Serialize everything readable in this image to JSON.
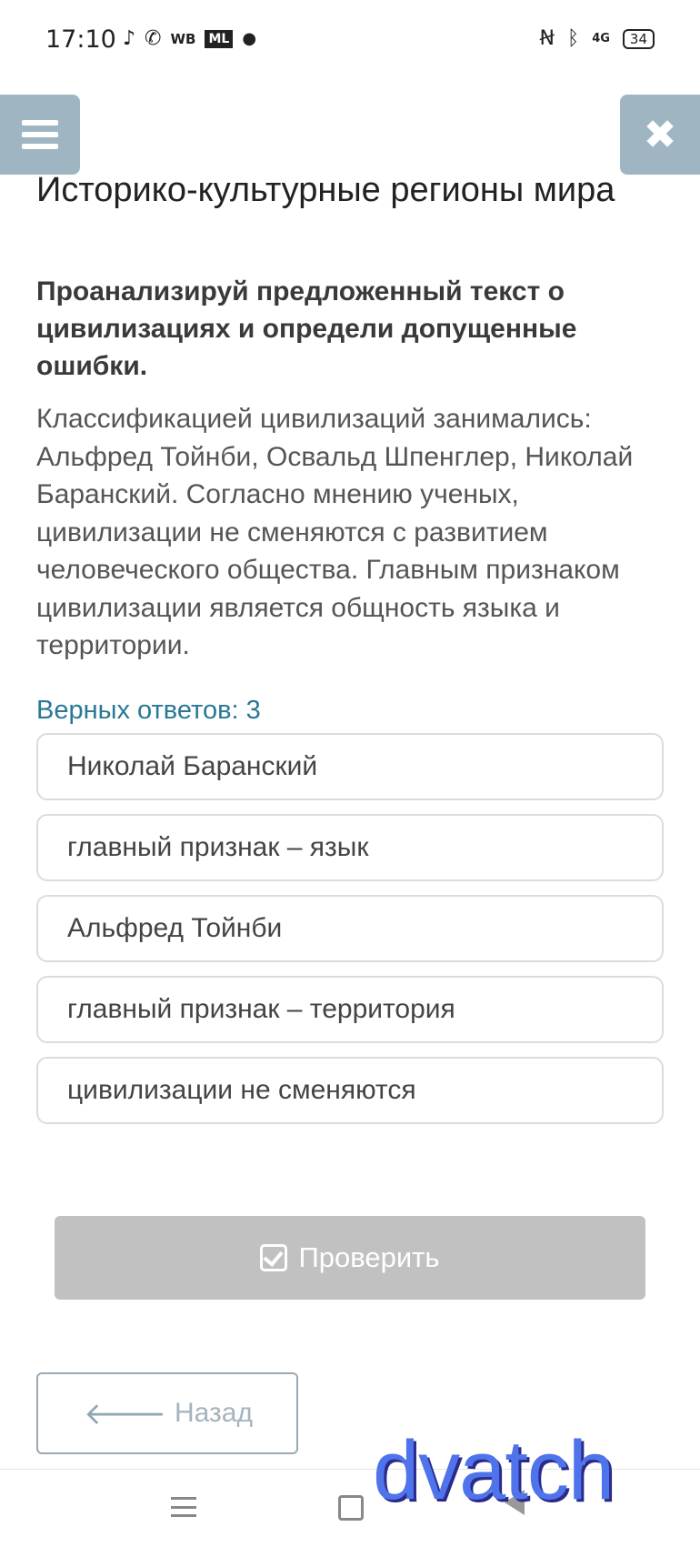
{
  "status_bar": {
    "time": "17:10",
    "left_icons": [
      "tiktok-icon",
      "whatsapp-icon",
      "wb-icon",
      "ml-icon",
      "dot"
    ],
    "wb_label": "WB",
    "ml_label": "ML",
    "network_label": "4G",
    "battery": "34"
  },
  "header": {
    "menu_icon": "hamburger-icon",
    "close_icon": "close-icon",
    "close_glyph": "✖"
  },
  "page": {
    "title": "Историко-культурные регионы мира",
    "task_heading": "Проанализируй предложенный текст о цивилизациях и определи допущенные ошибки.",
    "task_text": "Классификацией цивилизаций занимались: Альфред Тойнби, Освальд Шпенглер, Николай Баранский. Согласно мнению ученых, цивилизации не сменяются с развитием человеческого общества. Главным признаком цивилизации является общность языка и территории.",
    "correct_count_label": "Верных ответов: 3"
  },
  "options": [
    {
      "label": "Николай Баранский"
    },
    {
      "label": "главный признак – язык"
    },
    {
      "label": "Альфред Тойнби"
    },
    {
      "label": "главный признак – территория"
    },
    {
      "label": "цивилизации не сменяются"
    }
  ],
  "buttons": {
    "check_label": "Проверить",
    "back_label": "Назад",
    "back_arrow": "🡐"
  },
  "watermark": "dvatch",
  "colors": {
    "accent": "#2a7896",
    "header_button": "#9fb6c2",
    "check_button": "#c1c1c1"
  }
}
